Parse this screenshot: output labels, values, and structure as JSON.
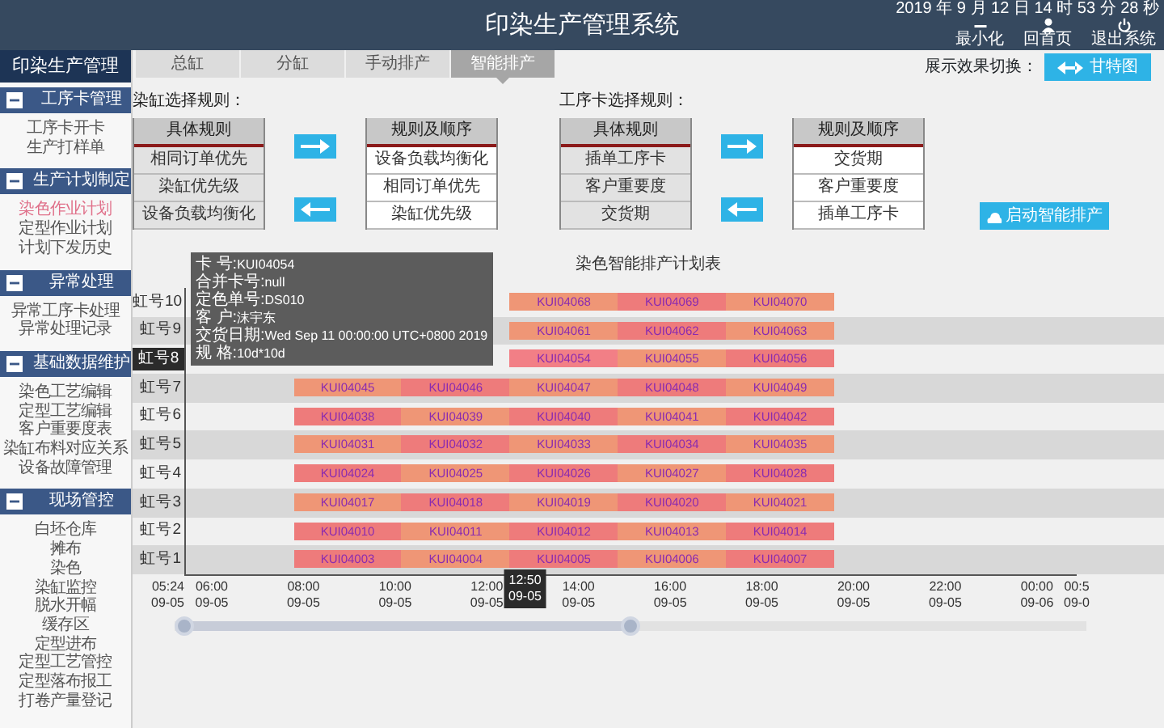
{
  "header": {
    "title": "印染生产管理系统",
    "datetime": "2019 年 9 月 12 日 14 时 53 分 28 秒",
    "actions": [
      {
        "kind": "minimize",
        "label": "最小化"
      },
      {
        "kind": "home",
        "label": "回首页"
      },
      {
        "kind": "logout",
        "label": "退出系统"
      }
    ]
  },
  "sidebar": {
    "title": "印染生产管理",
    "sections": [
      {
        "title": "工序卡管理",
        "expanded": true,
        "items": [
          {
            "label": "工序卡开卡",
            "selected": false
          },
          {
            "label": "生产打样单",
            "selected": false
          }
        ]
      },
      {
        "title": "生产计划制定",
        "expanded": true,
        "items": [
          {
            "label": "染色作业计划",
            "selected": true
          },
          {
            "label": "定型作业计划",
            "selected": false
          },
          {
            "label": "计划下发历史",
            "selected": false
          }
        ]
      },
      {
        "title": "异常处理",
        "expanded": true,
        "items": [
          {
            "label": "异常工序卡处理",
            "selected": false
          },
          {
            "label": "异常处理记录",
            "selected": false
          }
        ]
      },
      {
        "title": "基础数据维护",
        "expanded": true,
        "items": [
          {
            "label": "染色工艺编辑",
            "selected": false
          },
          {
            "label": "定型工艺编辑",
            "selected": false
          },
          {
            "label": "客户重要度表",
            "selected": false
          },
          {
            "label": "染缸布料对应关系",
            "selected": false
          },
          {
            "label": "设备故障管理",
            "selected": false
          }
        ]
      },
      {
        "title": "现场管控",
        "expanded": true,
        "items": [
          {
            "label": "白坯仓库",
            "selected": false
          },
          {
            "label": "摊布",
            "selected": false
          },
          {
            "label": "染色",
            "selected": false
          },
          {
            "label": "染缸监控",
            "selected": false
          },
          {
            "label": "脱水开幅",
            "selected": false
          },
          {
            "label": "缓存区",
            "selected": false
          },
          {
            "label": "定型进布",
            "selected": false
          },
          {
            "label": "定型工艺管控",
            "selected": false
          },
          {
            "label": "定型落布报工",
            "selected": false
          },
          {
            "label": "打卷产量登记",
            "selected": false
          }
        ]
      }
    ]
  },
  "tabs": [
    {
      "label": "总缸",
      "selected": false
    },
    {
      "label": "分缸",
      "selected": false
    },
    {
      "label": "手动排产",
      "selected": false
    },
    {
      "label": "智能排产",
      "selected": true
    }
  ],
  "view_switch": {
    "label": "展示效果切换：",
    "button": "甘特图"
  },
  "rule_groups": [
    {
      "title": "染缸选择规则：",
      "available": {
        "heading": "具体规则",
        "items": [
          "相同订单优先",
          "染缸优先级",
          "设备负载均衡化"
        ]
      },
      "ordered": {
        "heading": "规则及顺序",
        "items": [
          "设备负载均衡化",
          "相同订单优先",
          "染缸优先级"
        ]
      }
    },
    {
      "title": "工序卡选择规则：",
      "available": {
        "heading": "具体规则",
        "items": [
          "插单工序卡",
          "客户重要度",
          "交货期"
        ]
      },
      "ordered": {
        "heading": "规则及顺序",
        "items": [
          "交货期",
          "客户重要度",
          "插单工序卡"
        ]
      }
    }
  ],
  "start_button": "启动智能排产",
  "gantt": {
    "title": "染色智能排产计划表",
    "rows": [
      {
        "label": "虹号10",
        "selected": false,
        "bars": [
          {
            "card": "KUI04068",
            "color": "#ef9676"
          },
          {
            "card": "KUI04069",
            "color": "#ee7b7b"
          },
          {
            "card": "KUI04070",
            "color": "#ef9676"
          }
        ]
      },
      {
        "label": "虹号9",
        "selected": false,
        "bars": [
          {
            "card": "KUI04061",
            "color": "#ef9676"
          },
          {
            "card": "KUI04062",
            "color": "#ee7b7b"
          },
          {
            "card": "KUI04063",
            "color": "#ef9676"
          }
        ]
      },
      {
        "label": "虹号8",
        "selected": true,
        "bars": [
          {
            "card": "KUI04054",
            "color": "#f27f86"
          },
          {
            "card": "KUI04055",
            "color": "#ef9676"
          },
          {
            "card": "KUI04056",
            "color": "#ee7b7b"
          }
        ]
      },
      {
        "label": "虹号7",
        "selected": false,
        "bars": [
          {
            "card": "KUI04045",
            "color": "#ef9676"
          },
          {
            "card": "KUI04046",
            "color": "#ee7b7b"
          },
          {
            "card": "KUI04047",
            "color": "#ef9676"
          },
          {
            "card": "KUI04048",
            "color": "#ee7b7b"
          },
          {
            "card": "KUI04049",
            "color": "#ef9676"
          }
        ]
      },
      {
        "label": "虹号6",
        "selected": false,
        "bars": [
          {
            "card": "KUI04038",
            "color": "#ee7b7b"
          },
          {
            "card": "KUI04039",
            "color": "#ef9676"
          },
          {
            "card": "KUI04040",
            "color": "#ee7b7b"
          },
          {
            "card": "KUI04041",
            "color": "#ef9676"
          },
          {
            "card": "KUI04042",
            "color": "#ee7b7b"
          }
        ]
      },
      {
        "label": "虹号5",
        "selected": false,
        "bars": [
          {
            "card": "KUI04031",
            "color": "#ef9676"
          },
          {
            "card": "KUI04032",
            "color": "#ee7b7b"
          },
          {
            "card": "KUI04033",
            "color": "#ef9676"
          },
          {
            "card": "KUI04034",
            "color": "#ee7b7b"
          },
          {
            "card": "KUI04035",
            "color": "#ef9676"
          }
        ]
      },
      {
        "label": "虹号4",
        "selected": false,
        "bars": [
          {
            "card": "KUI04024",
            "color": "#ee7b7b"
          },
          {
            "card": "KUI04025",
            "color": "#ef9676"
          },
          {
            "card": "KUI04026",
            "color": "#ee7b7b"
          },
          {
            "card": "KUI04027",
            "color": "#ef9676"
          },
          {
            "card": "KUI04028",
            "color": "#ee7b7b"
          }
        ]
      },
      {
        "label": "虹号3",
        "selected": false,
        "bars": [
          {
            "card": "KUI04017",
            "color": "#ef9676"
          },
          {
            "card": "KUI04018",
            "color": "#ee7b7b"
          },
          {
            "card": "KUI04019",
            "color": "#ef9676"
          },
          {
            "card": "KUI04020",
            "color": "#ee7b7b"
          },
          {
            "card": "KUI04021",
            "color": "#ef9676"
          }
        ]
      },
      {
        "label": "虹号2",
        "selected": false,
        "bars": [
          {
            "card": "KUI04010",
            "color": "#ee7b7b"
          },
          {
            "card": "KUI04011",
            "color": "#ef9676"
          },
          {
            "card": "KUI04012",
            "color": "#ee7b7b"
          },
          {
            "card": "KUI04013",
            "color": "#ef9676"
          },
          {
            "card": "KUI04014",
            "color": "#ee7b7b"
          }
        ]
      },
      {
        "label": "虹号1",
        "selected": false,
        "bars": [
          {
            "card": "KUI04003",
            "color": "#ee7b7b"
          },
          {
            "card": "KUI04004",
            "color": "#ef9676"
          },
          {
            "card": "KUI04005",
            "color": "#ee7b7b"
          },
          {
            "card": "KUI04006",
            "color": "#ef9676"
          },
          {
            "card": "KUI04007",
            "color": "#ee7b7b"
          }
        ]
      }
    ],
    "ticks": [
      {
        "kind": "start",
        "time": "05:24",
        "date": "09-05"
      },
      {
        "kind": "hour",
        "time": "06:00",
        "date": "09-05"
      },
      {
        "kind": "hour",
        "time": "08:00",
        "date": "09-05"
      },
      {
        "kind": "hour",
        "time": "10:00",
        "date": "09-05"
      },
      {
        "kind": "hour",
        "time": "12:00",
        "date": "09-05"
      },
      {
        "kind": "hour",
        "time": "14:00",
        "date": "09-05"
      },
      {
        "kind": "hour",
        "time": "16:00",
        "date": "09-05"
      },
      {
        "kind": "hour",
        "time": "18:00",
        "date": "09-05"
      },
      {
        "kind": "hour",
        "time": "20:00",
        "date": "09-05"
      },
      {
        "kind": "hour",
        "time": "22:00",
        "date": "09-05"
      },
      {
        "kind": "hour",
        "time": "00:00",
        "date": "09-06"
      },
      {
        "kind": "end",
        "time": "00:5",
        "date": "09-0"
      }
    ],
    "cursor": {
      "time": "12:50",
      "date": "09-05"
    },
    "range": {
      "level": 0.5
    },
    "tooltip": {
      "lines": [
        {
          "label": "卡 号:",
          "value": "KUI04054"
        },
        {
          "label": "合并卡号:",
          "value": "null"
        },
        {
          "label": "定色单号:",
          "value": "DS010"
        },
        {
          "label": "客 户:",
          "value": "沫宇东"
        },
        {
          "label": "交货日期:",
          "value": "Wed Sep 11 00:00:00 UTC+0800 2019"
        },
        {
          "label": "规 格:",
          "value": "10d*10d"
        }
      ]
    }
  }
}
